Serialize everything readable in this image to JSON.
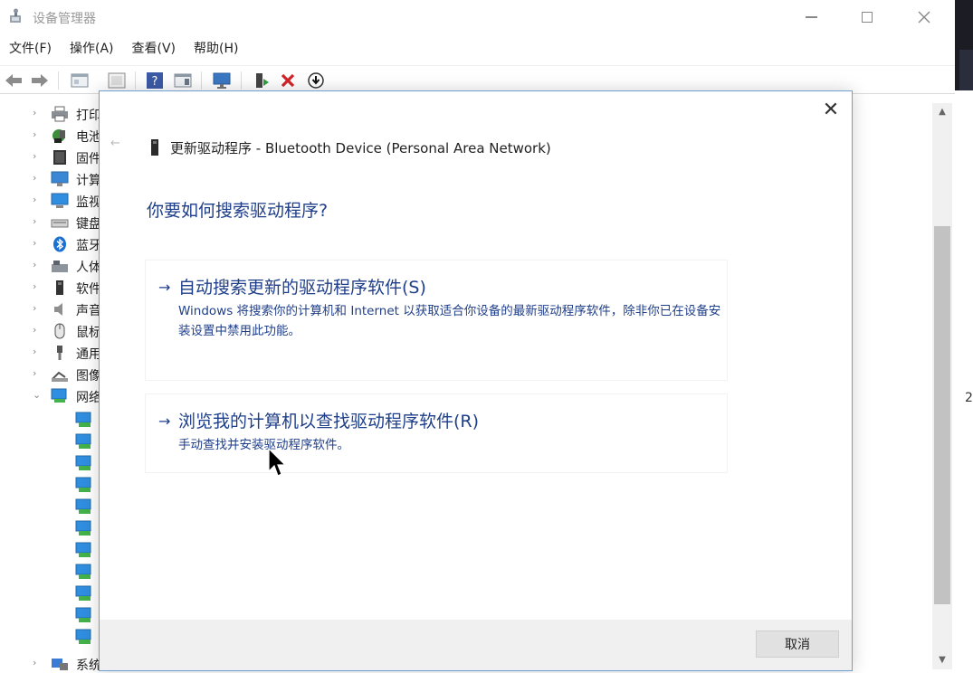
{
  "window": {
    "title": "设备管理器",
    "controls": {
      "minimize": "—",
      "maximize": "☐",
      "close": "✕"
    }
  },
  "menu": [
    "文件(F)",
    "操作(A)",
    "查看(V)",
    "帮助(H)"
  ],
  "toolbar": {
    "buttons": [
      "back-arrow",
      "forward-arrow",
      "properties",
      "show-hide",
      "help",
      "view",
      "scan-hardware",
      "update-driver",
      "uninstall",
      "disable"
    ]
  },
  "tree": {
    "items": [
      {
        "label": "打印",
        "icon": "printer-icon",
        "expanded": false
      },
      {
        "label": "电池",
        "icon": "battery-icon",
        "expanded": false
      },
      {
        "label": "固件",
        "icon": "firmware-icon",
        "expanded": false
      },
      {
        "label": "计算",
        "icon": "computer-icon",
        "expanded": false
      },
      {
        "label": "监视",
        "icon": "monitor-icon",
        "expanded": false
      },
      {
        "label": "键盘",
        "icon": "keyboard-icon",
        "expanded": false
      },
      {
        "label": "蓝牙",
        "icon": "bluetooth-icon",
        "expanded": false
      },
      {
        "label": "人体",
        "icon": "hid-icon",
        "expanded": false
      },
      {
        "label": "软件",
        "icon": "software-icon",
        "expanded": false
      },
      {
        "label": "声音",
        "icon": "sound-icon",
        "expanded": false
      },
      {
        "label": "鼠标",
        "icon": "mouse-icon",
        "expanded": false
      },
      {
        "label": "通用",
        "icon": "usb-icon",
        "expanded": false
      },
      {
        "label": "图像",
        "icon": "camera-icon",
        "expanded": false
      },
      {
        "label": "网络",
        "icon": "network-icon",
        "expanded": true
      }
    ],
    "network_children": 11,
    "last_item": "系统"
  },
  "edge_text": "2",
  "dialog": {
    "close": "✕",
    "back": "←",
    "header_title": "更新驱动程序 - Bluetooth Device (Personal Area Network)",
    "question": "你要如何搜索驱动程序?",
    "options": [
      {
        "arrow": "→",
        "title": "自动搜索更新的驱动程序软件(S)",
        "description": "Windows 将搜索你的计算机和 Internet 以获取适合你设备的最新驱动程序软件，除非你已在设备安装设置中禁用此功能。"
      },
      {
        "arrow": "→",
        "title": "浏览我的计算机以查找驱动程序软件(R)",
        "description": "手动查找并安装驱动程序软件。"
      }
    ],
    "cancel_label": "取消"
  },
  "colors": {
    "link_blue": "#1f3f8a",
    "dialog_border": "#6e9fd1",
    "footer_bg": "#f0f0f0"
  }
}
